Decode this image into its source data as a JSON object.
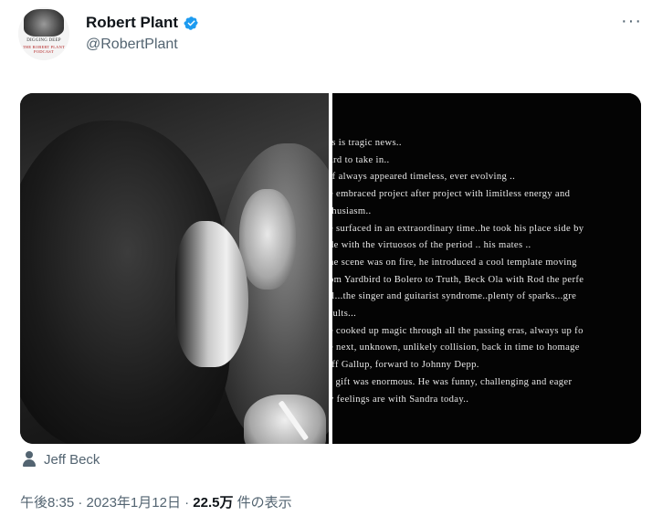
{
  "author": {
    "display_name": "Robert Plant",
    "handle": "@RobertPlant",
    "verified": true,
    "avatar_text_top": "DIGGING DEEP",
    "avatar_text_bottom": "THE ROBERT PLANT PODCAST"
  },
  "menu_icon": "more-dots-icon",
  "statement_lines": [
    "is is tragic news..",
    "ard to take in..",
    "ff always appeared timeless, ever evolving ..",
    "e embraced project after project with limitless energy and",
    "thusiasm..",
    "e surfaced in an extraordinary time..he took his place side by",
    "de with the virtuosos of the period .. his mates ..",
    "ne scene was on fire, he introduced a cool template moving",
    "om Yardbird to Bolero to Truth, Beck Ola with Rod the perfe",
    "il...the singer and guitarist syndrome..plenty of sparks...gre",
    "sults...",
    "e cooked up magic through all the passing eras, always up fo",
    "e next, unknown, unlikely collision, back in time to homage",
    "iff Gallup, forward to Johnny Depp.",
    "s gift was enormous. He was funny, challenging and eager",
    "y feelings are with Sandra today.."
  ],
  "tagged_person": "Jeff Beck",
  "meta": {
    "time": "午後8:35",
    "sep1": " · ",
    "date": "2023年1月12日",
    "sep2": " · ",
    "views": "22.5万",
    "views_label": " 件の表示"
  },
  "colors": {
    "verified_blue": "#1d9bf0",
    "secondary_text": "#536471",
    "primary_text": "#0f1419"
  }
}
